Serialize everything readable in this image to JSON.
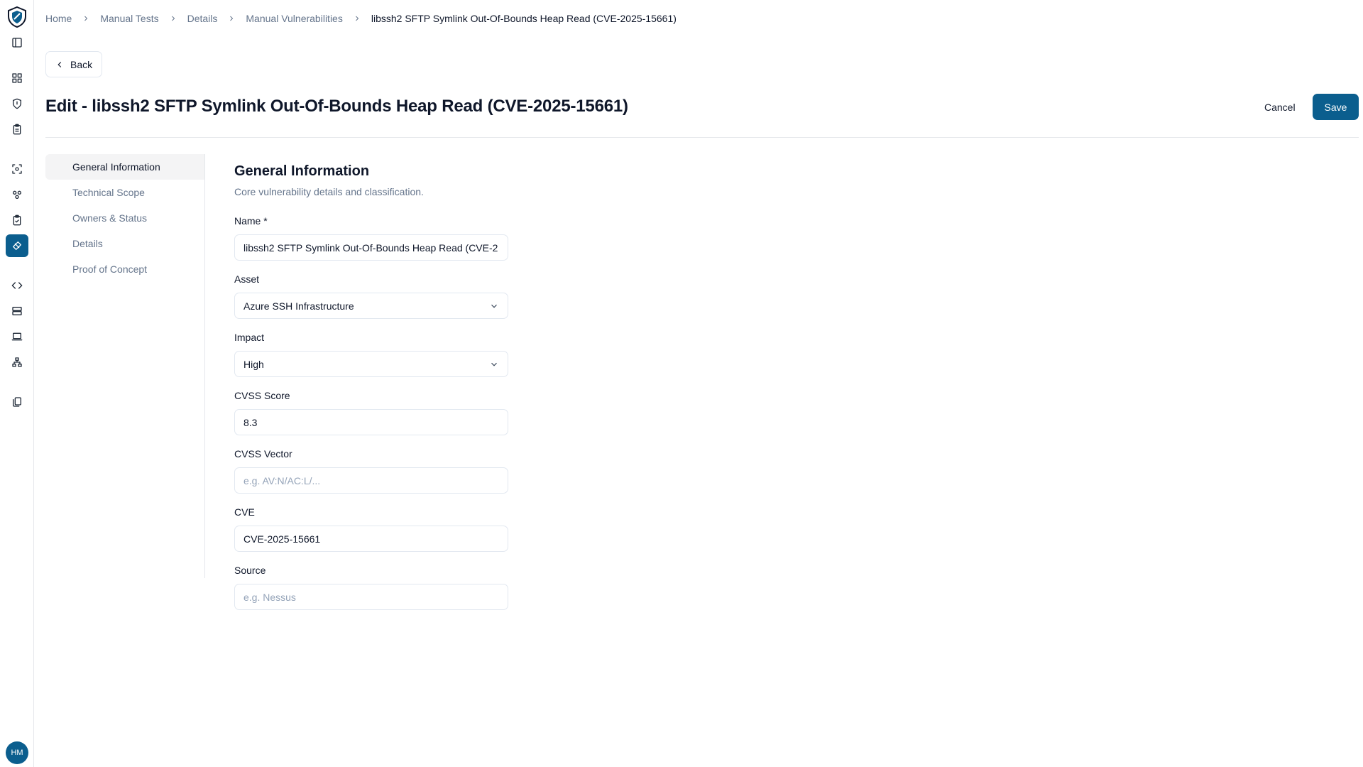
{
  "breadcrumb": [
    "Home",
    "Manual Tests",
    "Details",
    "Manual Vulnerabilities",
    "libssh2 SFTP Symlink Out-Of-Bounds Heap Read (CVE-2025-15661)"
  ],
  "back_label": "Back",
  "page_title": "Edit - libssh2 SFTP Symlink Out-Of-Bounds Heap Read (CVE-2025-15661)",
  "actions": {
    "cancel": "Cancel",
    "save": "Save"
  },
  "section_nav": [
    "General Information",
    "Technical Scope",
    "Owners & Status",
    "Details",
    "Proof of Concept"
  ],
  "form": {
    "title": "General Information",
    "description": "Core vulnerability details and classification.",
    "fields": [
      {
        "label": "Name *",
        "value": "libssh2 SFTP Symlink Out-Of-Bounds Heap Read (CVE-2"
      },
      {
        "label": "Asset",
        "value": "Azure SSH Infrastructure"
      },
      {
        "label": "Impact",
        "value": "High"
      },
      {
        "label": "CVSS Score",
        "value": "8.3"
      },
      {
        "label": "CVSS Vector",
        "placeholder": "e.g. AV:N/AC:L/..."
      },
      {
        "label": "CVE",
        "value": "CVE-2025-15661"
      },
      {
        "label": "Source",
        "placeholder": "e.g. Nessus"
      }
    ]
  },
  "user": {
    "initials": "HM"
  },
  "colors": {
    "accent": "#0b5e8e",
    "border": "#e2e8f0",
    "muted": "#64748b"
  }
}
